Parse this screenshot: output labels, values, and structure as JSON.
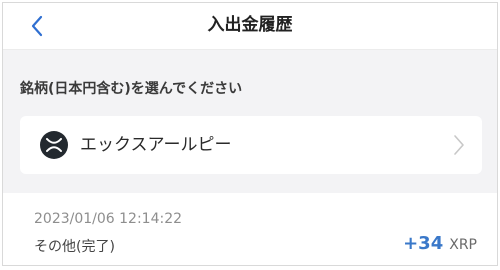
{
  "header": {
    "title": "入出金履歴",
    "back_icon": "chevron-left-icon",
    "accent": "#2f6fd1"
  },
  "section": {
    "label": "銘柄(日本円含む)を選んでください"
  },
  "selector": {
    "coin_name": "エックスアールピー",
    "coin_icon": "xrp-icon",
    "chevron_icon": "chevron-right-icon"
  },
  "history": {
    "items": [
      {
        "date": "2023/01/06 12:14:22",
        "type": "その他(完了)",
        "amount": "+34",
        "unit": "XRP",
        "amount_color": "#3a78c9"
      }
    ]
  }
}
